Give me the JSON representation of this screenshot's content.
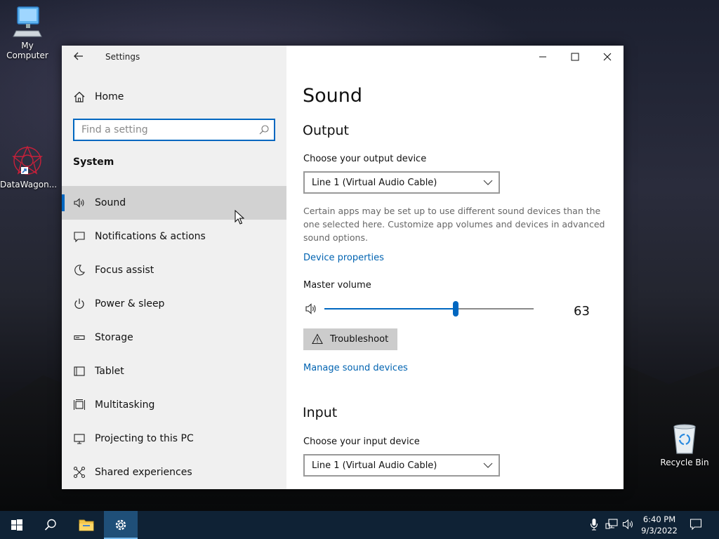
{
  "desktop": {
    "icons": [
      {
        "label": "My Computer",
        "icon": "computer-icon"
      },
      {
        "label": "DataWagon...",
        "icon": "datawagon-icon"
      },
      {
        "label": "Recycle Bin",
        "icon": "recycle-bin-icon"
      }
    ]
  },
  "window": {
    "title": "Settings",
    "controls": [
      "minimize-icon",
      "maximize-icon",
      "close-icon"
    ]
  },
  "sidebar": {
    "home_label": "Home",
    "search_placeholder": "Find a setting",
    "section_title": "System",
    "items": [
      {
        "label": "Sound",
        "icon": "speaker-icon",
        "selected": true
      },
      {
        "label": "Notifications & actions",
        "icon": "notification-icon"
      },
      {
        "label": "Focus assist",
        "icon": "moon-icon"
      },
      {
        "label": "Power & sleep",
        "icon": "power-icon"
      },
      {
        "label": "Storage",
        "icon": "storage-icon"
      },
      {
        "label": "Tablet",
        "icon": "tablet-icon"
      },
      {
        "label": "Multitasking",
        "icon": "multitasking-icon"
      },
      {
        "label": "Projecting to this PC",
        "icon": "projecting-icon"
      },
      {
        "label": "Shared experiences",
        "icon": "shared-icon"
      }
    ]
  },
  "content": {
    "page_title": "Sound",
    "output": {
      "heading": "Output",
      "device_label": "Choose your output device",
      "device_value": "Line 1 (Virtual Audio Cable)",
      "description": "Certain apps may be set up to use different sound devices than the one selected here. Customize app volumes and devices in advanced sound options.",
      "device_properties_link": "Device properties",
      "master_volume_label": "Master volume",
      "volume_value": "63",
      "volume_percent": 63,
      "troubleshoot_label": "Troubleshoot",
      "manage_devices_link": "Manage sound devices"
    },
    "input": {
      "heading": "Input",
      "device_label": "Choose your input device",
      "device_value": "Line 1 (Virtual Audio Cable)"
    }
  },
  "taskbar": {
    "time": "6:40 PM",
    "date": "9/3/2022",
    "accent_color": "#0067c0"
  }
}
